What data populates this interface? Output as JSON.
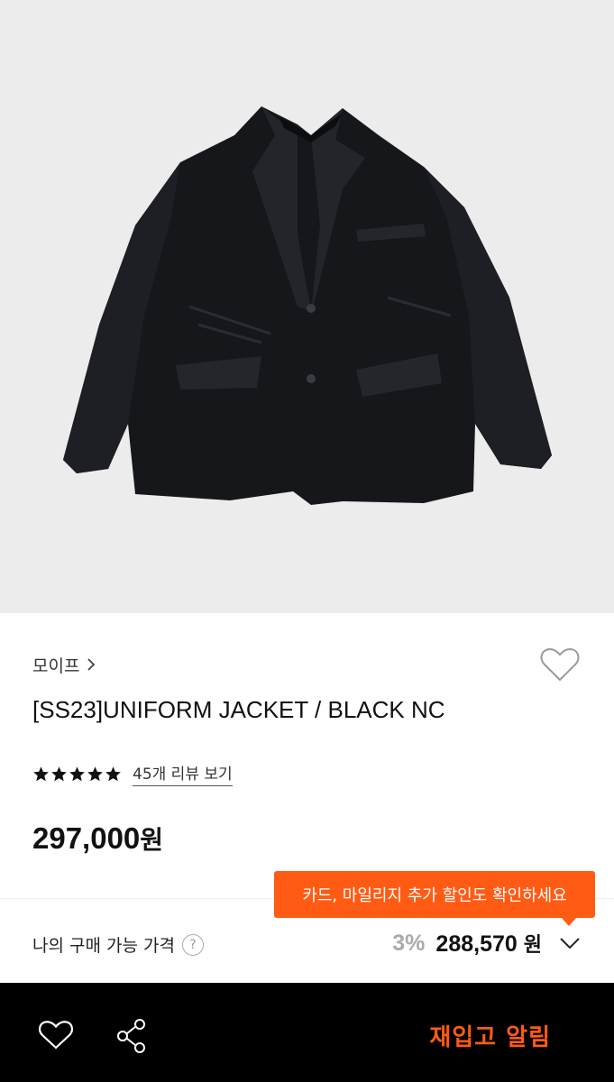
{
  "product": {
    "image_alt": "Black uniform jacket",
    "brand": "모이프",
    "title": "[SS23]UNIFORM JACKET / BLACK NC",
    "rating_stars": 5,
    "review_link": "45개 리뷰 보기",
    "price": "297,000",
    "price_unit": "원"
  },
  "benefit": {
    "tooltip": "카드, 마일리지 추가 할인도 확인하세요",
    "label": "나의 구매 가능 가격",
    "help_icon": "?",
    "discount": "3%",
    "price": "288,570",
    "price_unit": "원"
  },
  "bottom_bar": {
    "restock_label": "재입고 알림"
  },
  "colors": {
    "accent": "#ff5b14",
    "bar_bg": "#000000",
    "hero_bg": "#ececec"
  },
  "icons": [
    "chevron-right-icon",
    "heart-outline-icon",
    "star-icon",
    "question-circle-icon",
    "chevron-down-icon",
    "share-icon"
  ]
}
